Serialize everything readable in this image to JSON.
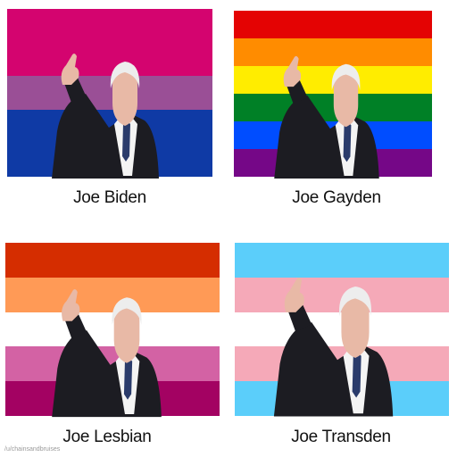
{
  "panels": [
    {
      "caption": "Joe Biden",
      "stripes": [
        "#d4046f",
        "#d4046f",
        "#9a4f96",
        "#0f3aa5",
        "#0f3aa5"
      ]
    },
    {
      "caption": "Joe Gayden",
      "stripes": [
        "#e40303",
        "#ff8c00",
        "#ffed00",
        "#008026",
        "#004dff",
        "#750787"
      ]
    },
    {
      "caption": "Joe Lesbian",
      "stripes": [
        "#d52d00",
        "#ff9a56",
        "#ffffff",
        "#d362a4",
        "#a30262"
      ]
    },
    {
      "caption": "Joe Transden",
      "stripes": [
        "#5bcefa",
        "#f5a9b8",
        "#ffffff",
        "#f5a9b8",
        "#5bcefa"
      ]
    }
  ],
  "watermark": "/u/chainsandbruises",
  "colors": {
    "suit": "#1c1c22",
    "skin": "#e8b9a6",
    "hair": "#ededed",
    "shirt": "#f4f4f4",
    "tie": "#2a3b6b"
  }
}
